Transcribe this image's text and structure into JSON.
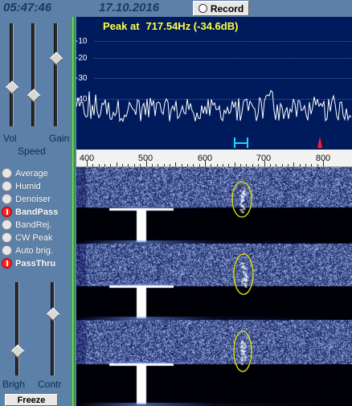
{
  "topbar": {
    "time": "05:47:46",
    "date": "17.10.2016",
    "record_label": "Record"
  },
  "sliders": {
    "vol_label": "Vol",
    "speed_label": "Speed",
    "gain_label": "Gain",
    "brightness_label": "Brigh",
    "contrast_label": "Contr"
  },
  "options": [
    {
      "label": "Average",
      "selected": false
    },
    {
      "label": "Humid",
      "selected": false
    },
    {
      "label": "Denoiser",
      "selected": false
    },
    {
      "label": "BandPass",
      "selected": true
    },
    {
      "label": "BandRej.",
      "selected": false
    },
    {
      "label": "CW Peak",
      "selected": false
    },
    {
      "label": "Auto brig.",
      "selected": false
    },
    {
      "label": "PassThru",
      "selected": true
    }
  ],
  "freeze_label": "Freeze",
  "spectrum": {
    "peak_prefix": "Peak at",
    "peak_value": "717.54Hz (-34.6dB)",
    "y_labels": [
      "-10",
      "-20",
      "-30",
      "-40"
    ]
  },
  "scale": {
    "labels": [
      "400",
      "500",
      "600",
      "700",
      "800"
    ]
  },
  "colors": {
    "panel": "#5c80a8",
    "spectrum_bg": "#001b5c",
    "peak_text": "#ffff40",
    "marker_cyan": "#19d9ff",
    "marker_red": "#ff2020",
    "highlight_ellipse": "#e6e600"
  }
}
